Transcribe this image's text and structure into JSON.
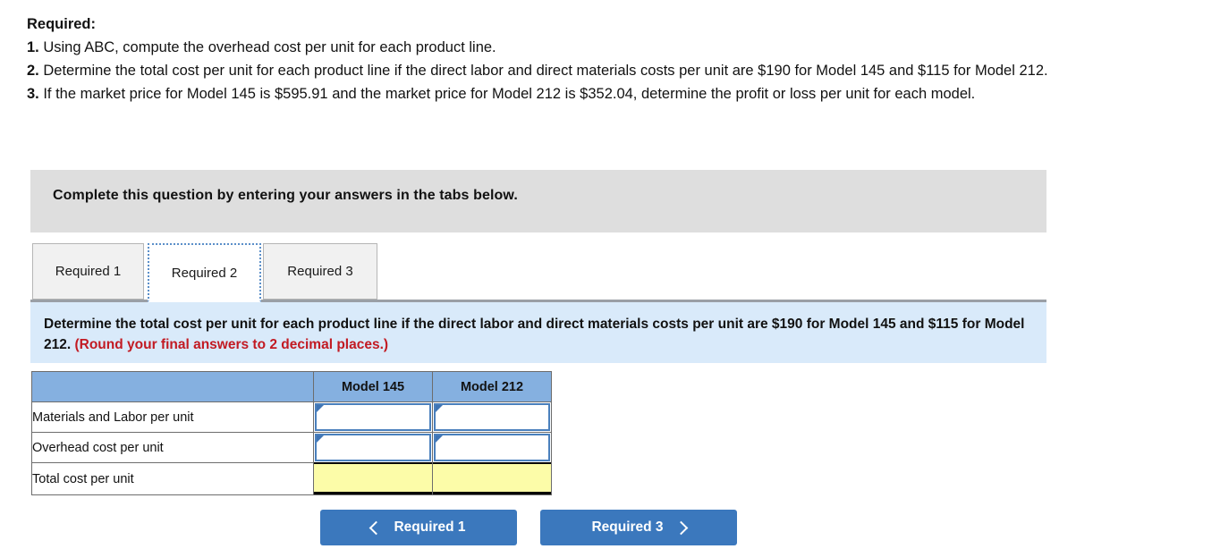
{
  "prompt": {
    "title": "Required:",
    "items": [
      {
        "num": "1.",
        "text": " Using ABC, compute the overhead cost per unit for each product line."
      },
      {
        "num": "2.",
        "text": " Determine the total cost per unit for each product line if the direct labor and direct materials costs per unit are $190 for Model 145 and $115 for Model 212."
      },
      {
        "num": "3.",
        "text": " If the market price for Model 145 is $595.91 and the market price for Model 212 is $352.04, determine the profit or loss per unit for each model."
      }
    ]
  },
  "complete_bar": {
    "text": "Complete this question by entering your answers in the tabs below."
  },
  "tabs": [
    {
      "label": "Required 1",
      "active": false
    },
    {
      "label": "Required 2",
      "active": true
    },
    {
      "label": "Required 3",
      "active": false
    }
  ],
  "instruction": {
    "main": "Determine the total cost per unit for each product line if the direct labor and direct materials costs per unit are $190 for Model 145 and $115 for Model 212.",
    "round_note": "(Round your final answers to 2 decimal places.)"
  },
  "table": {
    "blank_header": "",
    "columns": [
      "Model 145",
      "Model 212"
    ],
    "rows": [
      {
        "label": "Materials and Labor per unit",
        "type": "input",
        "values": [
          "",
          ""
        ]
      },
      {
        "label": "Overhead cost per unit",
        "type": "input",
        "values": [
          "",
          ""
        ]
      },
      {
        "label": "Total cost per unit",
        "type": "total",
        "values": [
          "",
          ""
        ]
      }
    ]
  },
  "nav": {
    "prev_label": "Required 1",
    "next_label": "Required 3",
    "prev_icon": "chevron-left-icon",
    "next_icon": "chevron-right-icon"
  },
  "colors": {
    "header_blue": "#85b0e0",
    "banner_blue": "#d9eafa",
    "grey_bar": "#dedede",
    "total_yellow": "#fcfca8",
    "button_blue": "#3b78bd",
    "round_red": "#c21a22",
    "input_border": "#4a80bd"
  }
}
